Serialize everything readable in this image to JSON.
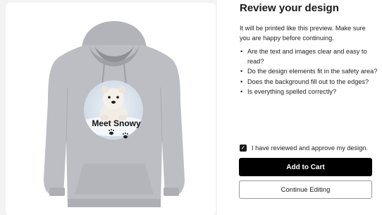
{
  "dialog": {
    "title": "Review your design",
    "intro": "It will be printed like this preview. Make sure you are happy before continuing.",
    "checklist": [
      "Are the text and images clear and easy to read?",
      "Do the design elements fit in the safety area?",
      "Does the background fill out to the edges?",
      "Is everything spelled correctly?"
    ],
    "approve_label": "I have reviewed and approve my design.",
    "approve_checked": true,
    "add_to_cart_label": "Add to Cart",
    "continue_editing_label": "Continue Editing"
  },
  "preview": {
    "design_text": "Meet Snowy",
    "hoodie_color": "#b9bbc0",
    "icons": [
      "polar-bear-photo",
      "paw-prints-icon"
    ]
  },
  "colors": {
    "primary_button": "#000000",
    "page_background": "#f3f3f3"
  }
}
